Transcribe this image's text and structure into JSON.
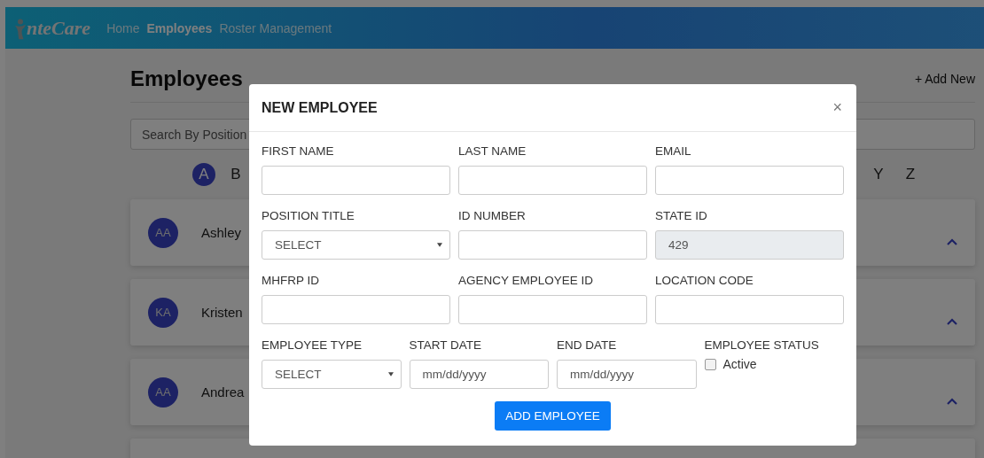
{
  "navbar": {
    "brand": "nteCare",
    "links": [
      {
        "label": "Home",
        "selected": false
      },
      {
        "label": "Employees",
        "selected": true
      },
      {
        "label": "Roster Management",
        "selected": false
      }
    ]
  },
  "page": {
    "title": "Employees",
    "add_link": "+ Add New",
    "search": {
      "placeholder": "Search By Position"
    },
    "letters_left": [
      {
        "label": "A",
        "selected": true
      },
      {
        "label": "B",
        "selected": false
      }
    ],
    "letters_right": [
      {
        "label": "Y",
        "selected": false
      },
      {
        "label": "Z",
        "selected": false
      }
    ],
    "employees": [
      {
        "initials": "AA",
        "name": "Ashley"
      },
      {
        "initials": "KA",
        "name": "Kristen"
      },
      {
        "initials": "AA",
        "name": "Andrea"
      }
    ]
  },
  "modal": {
    "title": "NEW EMPLOYEE",
    "close": "×",
    "rows": [
      {
        "fields": [
          {
            "label": "FIRST NAME",
            "kind": "text",
            "disabled": false
          },
          {
            "label": "LAST NAME",
            "kind": "text",
            "disabled": false
          },
          {
            "label": "EMAIL",
            "kind": "text",
            "disabled": false
          }
        ]
      },
      {
        "fields": [
          {
            "label": "POSITION TITLE",
            "kind": "select",
            "value": "SELECT",
            "disabled": false
          },
          {
            "label": "ID NUMBER",
            "kind": "text",
            "disabled": false
          },
          {
            "label": "STATE ID",
            "kind": "text",
            "value": "429",
            "disabled": true
          }
        ]
      },
      {
        "fields": [
          {
            "label": "MHFRP ID",
            "kind": "text",
            "disabled": false
          },
          {
            "label": "AGENCY EMPLOYEE ID",
            "kind": "text",
            "disabled": false
          },
          {
            "label": "LOCATION CODE",
            "kind": "text",
            "disabled": false
          }
        ]
      },
      {
        "fields": [
          {
            "label": "EMPLOYEE TYPE",
            "kind": "select",
            "value": "SELECT",
            "disabled": false
          },
          {
            "label": "START DATE",
            "kind": "text",
            "placeholder": "mm/dd/yyyy",
            "disabled": false
          },
          {
            "label": "END DATE",
            "kind": "text",
            "placeholder": "mm/dd/yyyy",
            "disabled": false
          },
          {
            "label": "EMPLOYEE STATUS",
            "kind": "checkbox",
            "option": "Active",
            "checked": false,
            "disabled": false
          }
        ]
      }
    ],
    "submit": "ADD EMPLOYEE"
  }
}
